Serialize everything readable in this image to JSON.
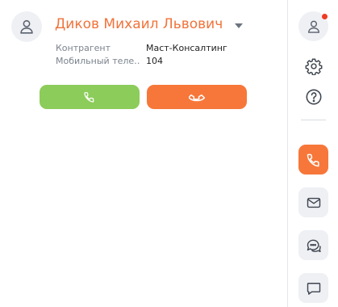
{
  "contact": {
    "name": "Диков Михаил Львович",
    "fields": [
      {
        "label": "Контрагент",
        "value": "Маст-Консалтинг"
      },
      {
        "label": "Мобильный теле…",
        "value": "104"
      }
    ]
  },
  "actions": {
    "call_icon": "phone-icon",
    "hangup_icon": "phone-hangup-icon"
  },
  "sidebar": {
    "items": [
      {
        "icon": "user-icon",
        "notification": true
      },
      {
        "icon": "gear-icon"
      },
      {
        "icon": "help-icon"
      },
      {
        "icon": "phone-icon",
        "active": true
      },
      {
        "icon": "mail-icon"
      },
      {
        "icon": "chat-icon"
      },
      {
        "icon": "message-icon"
      }
    ]
  },
  "colors": {
    "accent": "#f7773a",
    "call_green": "#8ccc5a",
    "name_orange": "#f0733b",
    "notification_red": "#ef3b24"
  }
}
